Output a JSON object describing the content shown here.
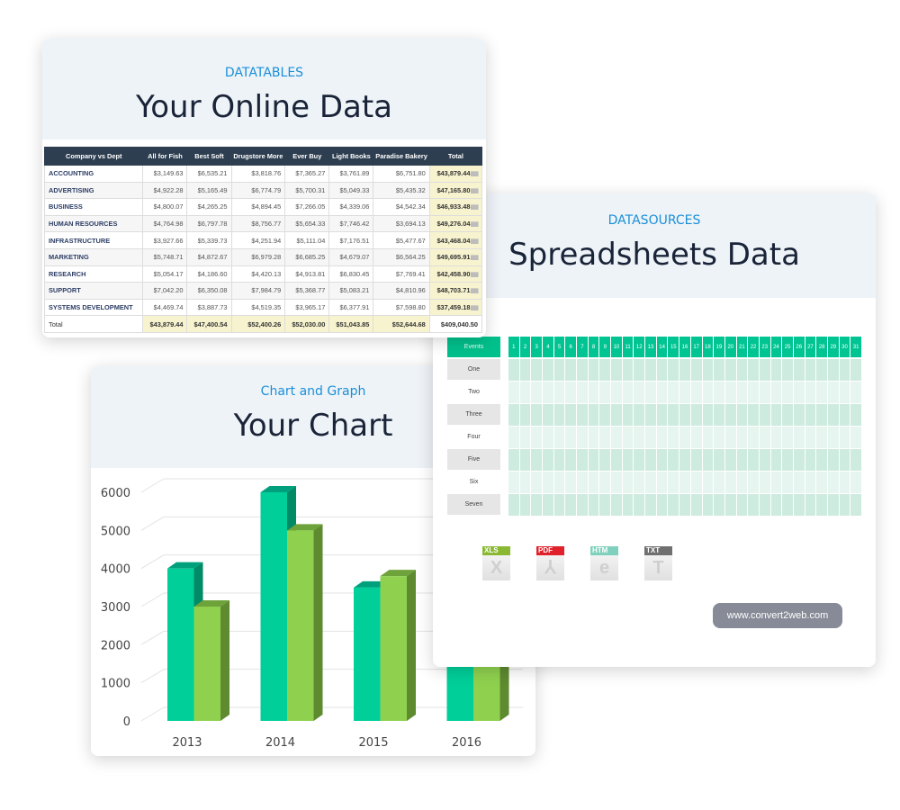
{
  "datatables": {
    "kicker": "DATATABLES",
    "title": "Your Online Data",
    "columns": [
      "Company vs Dept",
      "All for Fish",
      "Best Soft",
      "Drugstore More",
      "Ever Buy",
      "Light Books",
      "Paradise Bakery",
      "Total"
    ],
    "rows": [
      [
        "ACCOUNTING",
        "$3,149.63",
        "$6,535.21",
        "$3,818.76",
        "$7,365.27",
        "$3,761.89",
        "$6,751.80",
        "$43,879.44"
      ],
      [
        "ADVERTISING",
        "$4,922.28",
        "$5,165.49",
        "$6,774.79",
        "$5,700.31",
        "$5,049.33",
        "$5,435.32",
        "$47,165.80"
      ],
      [
        "BUSINESS",
        "$4,800.07",
        "$4,265.25",
        "$4,894.45",
        "$7,266.05",
        "$4,339.06",
        "$4,542.34",
        "$46,933.48"
      ],
      [
        "HUMAN RESOURCES",
        "$4,764.98",
        "$6,797.78",
        "$8,756.77",
        "$5,654.33",
        "$7,746.42",
        "$3,694.13",
        "$49,276.04"
      ],
      [
        "INFRASTRUCTURE",
        "$3,927.66",
        "$5,339.73",
        "$4,251.94",
        "$5,111.04",
        "$7,176.51",
        "$5,477.67",
        "$43,468.04"
      ],
      [
        "MARKETING",
        "$5,748.71",
        "$4,872.67",
        "$6,979.28",
        "$6,685.25",
        "$4,679.07",
        "$6,564.25",
        "$49,695.91"
      ],
      [
        "RESEARCH",
        "$5,054.17",
        "$4,186.60",
        "$4,420.13",
        "$4,913.81",
        "$6,830.45",
        "$7,769.41",
        "$42,458.90"
      ],
      [
        "SUPPORT",
        "$7,042.20",
        "$6,350.08",
        "$7,984.79",
        "$5,368.77",
        "$5,083.21",
        "$4,810.96",
        "$48,703.71"
      ],
      [
        "SYSTEMS DEVELOPMENT",
        "$4,469.74",
        "$3,887.73",
        "$4,519.35",
        "$3,965.17",
        "$6,377.91",
        "$7,598.80",
        "$37,459.18"
      ]
    ],
    "total_row": [
      "Total",
      "$43,879.44",
      "$47,400.54",
      "$52,400.26",
      "$52,030.00",
      "$51,043.85",
      "$52,644.68",
      "$409,040.50"
    ],
    "spark_glyph": "▮▮▮"
  },
  "datasources": {
    "kicker": "DATASOURCES",
    "title": "Spreadsheets Data",
    "header_label": "Events",
    "rows": [
      "One",
      "Two",
      "Three",
      "Four",
      "Five",
      "Six",
      "Seven"
    ],
    "days": [
      "1",
      "2",
      "3",
      "4",
      "5",
      "6",
      "7",
      "8",
      "9",
      "10",
      "11",
      "12",
      "13",
      "14",
      "15",
      "16",
      "17",
      "18",
      "19",
      "20",
      "21",
      "22",
      "23",
      "24",
      "25",
      "26",
      "27",
      "28",
      "29",
      "30",
      "31"
    ],
    "file_icons": [
      {
        "label": "XLS",
        "glyph": "X",
        "color": "#8ab833"
      },
      {
        "label": "PDF",
        "glyph": "⅄",
        "color": "#e0202a"
      },
      {
        "label": "HTM",
        "glyph": "e",
        "color": "#7fd1bd"
      },
      {
        "label": "TXT",
        "glyph": "T",
        "color": "#707070"
      }
    ],
    "url": "www.convert2web.com"
  },
  "chart": {
    "kicker": "Chart and Graph",
    "title": "Your Chart"
  },
  "chart_data": {
    "type": "bar",
    "categories": [
      "2013",
      "2014",
      "2015",
      "2016"
    ],
    "series": [
      {
        "values": [
          4000,
          6000,
          3500,
          null
        ],
        "color": "#00cf9a"
      },
      {
        "values": [
          3000,
          5000,
          3800,
          null
        ],
        "color": "#8fd14f"
      }
    ],
    "ylim": [
      0,
      6000
    ],
    "yticks": [
      "0",
      "1000",
      "2000",
      "3000",
      "4000",
      "5000",
      "6000"
    ],
    "grid": true,
    "style": "3d-column"
  }
}
